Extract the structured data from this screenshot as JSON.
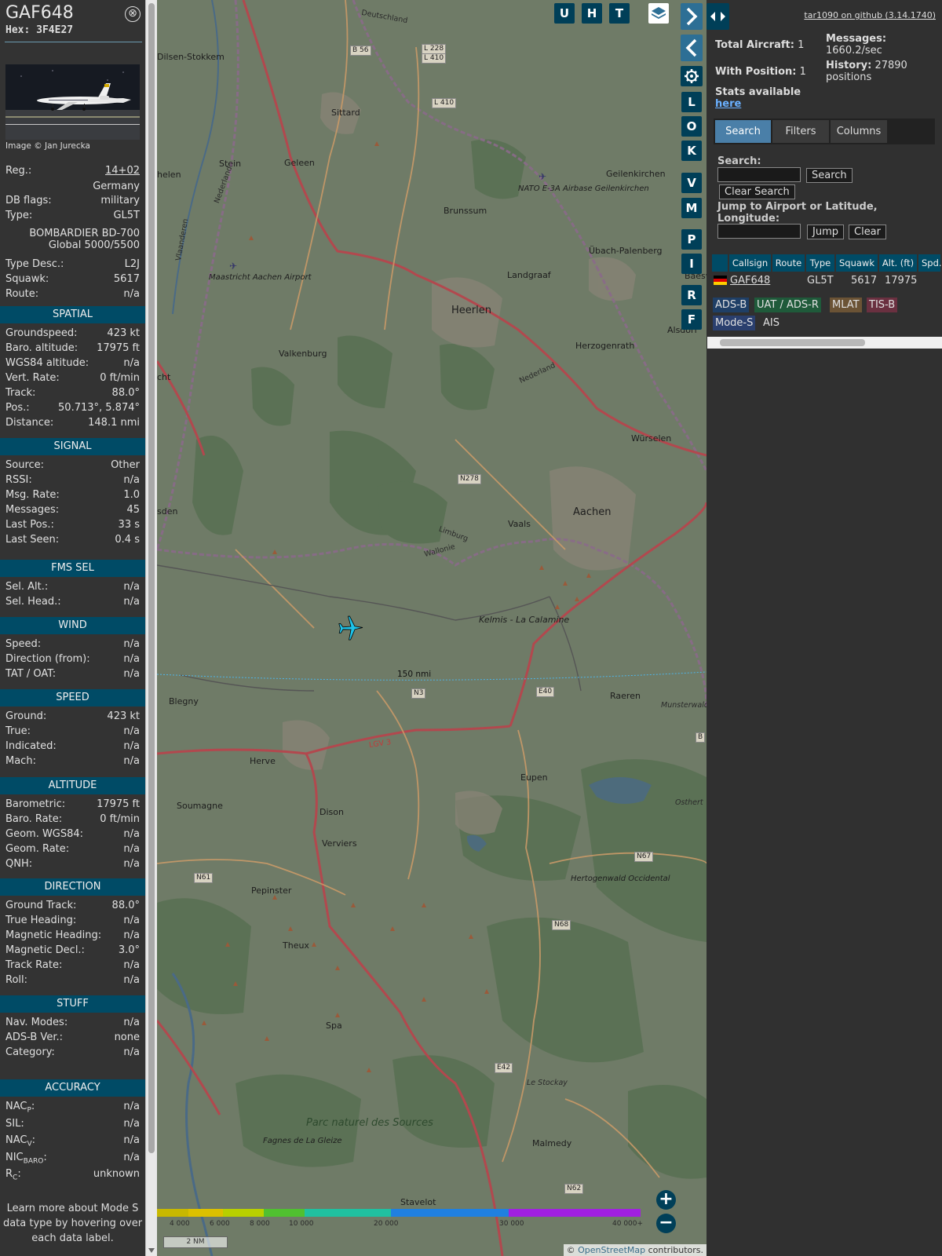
{
  "aircraft": {
    "callsign": "GAF648",
    "hex_label": "Hex:",
    "hex": "3F4E27",
    "close_symbol": "⊗",
    "image_credit": "Image © Jan Jurecka",
    "reg_label": "Reg.:",
    "reg": "14+02",
    "country": "Germany",
    "dbflags_label": "DB flags:",
    "dbflags": "military",
    "type_label": "Type:",
    "type": "GL5T",
    "type_full_1": "BOMBARDIER BD-700",
    "type_full_2": "Global 5000/5500",
    "typedesc_label": "Type Desc.:",
    "typedesc": "L2J",
    "squawk_label": "Squawk:",
    "squawk": "5617",
    "route_label": "Route:",
    "route": "n/a"
  },
  "sections": {
    "spatial": {
      "title": "SPATIAL",
      "rows": [
        {
          "label": "Groundspeed:",
          "value": "423 kt"
        },
        {
          "label": "Baro. altitude:",
          "value": "17975 ft"
        },
        {
          "label": "WGS84 altitude:",
          "value": "n/a"
        },
        {
          "label": "Vert. Rate:",
          "value": "0 ft/min"
        },
        {
          "label": "Track:",
          "value": "88.0°"
        },
        {
          "label": "Pos.:",
          "value": "50.713°, 5.874°"
        },
        {
          "label": "Distance:",
          "value": "148.1 nmi"
        }
      ]
    },
    "signal": {
      "title": "SIGNAL",
      "rows": [
        {
          "label": "Source:",
          "value": "Other"
        },
        {
          "label": "RSSI:",
          "value": "n/a"
        },
        {
          "label": "Msg. Rate:",
          "value": "1.0"
        },
        {
          "label": "Messages:",
          "value": "45"
        },
        {
          "label": "Last Pos.:",
          "value": "33 s"
        },
        {
          "label": "Last Seen:",
          "value": "0.4 s"
        }
      ]
    },
    "fms": {
      "title": "FMS SEL",
      "rows": [
        {
          "label": "Sel. Alt.:",
          "value": "n/a"
        },
        {
          "label": "Sel. Head.:",
          "value": "n/a"
        }
      ]
    },
    "wind": {
      "title": "WIND",
      "rows": [
        {
          "label": "Speed:",
          "value": "n/a"
        },
        {
          "label": "Direction (from):",
          "value": "n/a"
        },
        {
          "label": "TAT / OAT:",
          "value": "n/a"
        }
      ]
    },
    "speed": {
      "title": "SPEED",
      "rows": [
        {
          "label": "Ground:",
          "value": "423 kt"
        },
        {
          "label": "True:",
          "value": "n/a"
        },
        {
          "label": "Indicated:",
          "value": "n/a"
        },
        {
          "label": "Mach:",
          "value": "n/a"
        }
      ]
    },
    "altitude": {
      "title": "ALTITUDE",
      "rows": [
        {
          "label": "Barometric:",
          "value": "17975 ft"
        },
        {
          "label": "Baro. Rate:",
          "value": "0 ft/min"
        },
        {
          "label": "Geom. WGS84:",
          "value": "n/a"
        },
        {
          "label": "Geom. Rate:",
          "value": "n/a"
        },
        {
          "label": "QNH:",
          "value": "n/a"
        }
      ]
    },
    "direction": {
      "title": "DIRECTION",
      "rows": [
        {
          "label": "Ground Track:",
          "value": "88.0°"
        },
        {
          "label": "True Heading:",
          "value": "n/a"
        },
        {
          "label": "Magnetic Heading:",
          "value": "n/a"
        },
        {
          "label": "Magnetic Decl.:",
          "value": "3.0°"
        },
        {
          "label": "Track Rate:",
          "value": "n/a"
        },
        {
          "label": "Roll:",
          "value": "n/a"
        }
      ]
    },
    "stuff": {
      "title": "STUFF",
      "rows": [
        {
          "label": "Nav. Modes:",
          "value": "n/a"
        },
        {
          "label": "ADS-B Ver.:",
          "value": "none"
        },
        {
          "label": "Category:",
          "value": "n/a"
        }
      ]
    },
    "accuracy": {
      "title": "ACCURACY",
      "rows": [
        {
          "label": "NAC",
          "sub": "P",
          "value": "n/a"
        },
        {
          "label": "SIL:",
          "sub": "",
          "value": "n/a"
        },
        {
          "label": "NAC",
          "sub": "V",
          "value": "n/a"
        },
        {
          "label": "NIC",
          "sub": "BARO",
          "value": "n/a"
        },
        {
          "label": "R",
          "sub": "C",
          "value": "unknown"
        }
      ]
    }
  },
  "learn_more": "Learn more about Mode S data type by hovering over each data label.",
  "map": {
    "toolbar": {
      "u": "U",
      "h": "H",
      "t": "T"
    },
    "side_buttons": [
      "L",
      "O",
      "K",
      "V",
      "M",
      "P",
      "I",
      "R",
      "F"
    ],
    "range_ring_label": "150 nmi",
    "scale_label": "2 NM",
    "zoom_in": "+",
    "zoom_out": "−",
    "attribution_prefix": "© ",
    "attribution_link": "OpenStreetMap",
    "attribution_suffix": " contributors.",
    "altitude_legend": [
      "4 000",
      "6 000",
      "8 000",
      "10 000",
      "20 000",
      "30 000",
      "40 000+"
    ],
    "places": {
      "dilsen": "Dilsen-Stokkem",
      "deutschland": "Deutschland",
      "sittard": "Sittard",
      "stein": "Stein",
      "geleen": "Geleen",
      "helen": "helen",
      "brunssum": "Brunssum",
      "geilenkirchen": "Geilenkirchen",
      "nato": "NATO E-3A Airbase Geilenkirchen",
      "ubach": "Übach-Palenberg",
      "landgraaf": "Landgraaf",
      "maastricht": "Maastricht Aachen Airport",
      "heerlen": "Heerlen",
      "baesw": "Baesw",
      "alsdorf": "Alsdorf",
      "herzogenrath": "Herzogenrath",
      "valkenburg": "Valkenburg",
      "cht": "cht",
      "nederland": "Nederland",
      "wurselen": "Würselen",
      "aachen": "Aachen",
      "vaals": "Vaals",
      "sden": "sden",
      "limburg": "Limburg",
      "wallonie": "Wallonie",
      "kelmis": "Kelmis - La Calamine",
      "blegny": "Blegny",
      "raeren": "Raeren",
      "munsterwald": "Munsterwald",
      "herve": "Herve",
      "eupen": "Eupen",
      "soumagne": "Soumagne",
      "dison": "Dison",
      "osthert": "Osthert",
      "verviers": "Verviers",
      "pepinster": "Pepinster",
      "hertogenwald": "Hertogenwald Occidental",
      "theux": "Theux",
      "spa": "Spa",
      "le_stockay": "Le Stockay",
      "parc": "Parc naturel des Sources",
      "fagnes": "Fagnes de La Gleize",
      "malmedy": "Malmedy",
      "stavelot": "Stavelot",
      "vlaanderen": "Vlaanderen",
      "lgv3": "LGV 3"
    },
    "roads": {
      "b56": "B 56",
      "l228": "L 228",
      "l410a": "L 410",
      "l410b": "L 410",
      "n278": "N278",
      "n3": "N3",
      "e40": "E40",
      "n61": "N61",
      "n67": "N67",
      "n68": "N68",
      "e42": "E42",
      "n62": "N62",
      "b": "B"
    }
  },
  "right": {
    "github": "tar1090 on github (3.14.1740)",
    "total_label": "Total Aircraft:",
    "total": "1",
    "withpos_label": "With Position:",
    "withpos": "1",
    "messages_label": "Messages:",
    "messages": "1660.2/sec",
    "history_label": "History:",
    "history": "27890 positions",
    "stats_text": "Stats available",
    "stats_link": "here",
    "tabs": [
      "Search",
      "Filters",
      "Columns"
    ],
    "search_label": "Search:",
    "search_btn": "Search",
    "clear_search_btn": "Clear Search",
    "jump_label": "Jump to Airport or Latitude, Longitude:",
    "jump_btn": "Jump",
    "clear_btn": "Clear",
    "table_headers": [
      "Callsign",
      "Route",
      "Type",
      "Squawk",
      "Alt. (ft)",
      "Spd."
    ],
    "table_row": {
      "callsign": "GAF648",
      "route": "",
      "type": "GL5T",
      "squawk": "5617",
      "alt": "17975"
    },
    "badges": [
      "ADS-B",
      "UAT / ADS-R",
      "MLAT",
      "TIS-B",
      "Mode-S",
      "AIS"
    ],
    "badge_colors": {
      "adsb": "#1f3f66",
      "uat": "#1f5a3a",
      "mlat": "#6b5335",
      "tisb": "#6a3040",
      "modes": "#2a3f6e"
    }
  }
}
